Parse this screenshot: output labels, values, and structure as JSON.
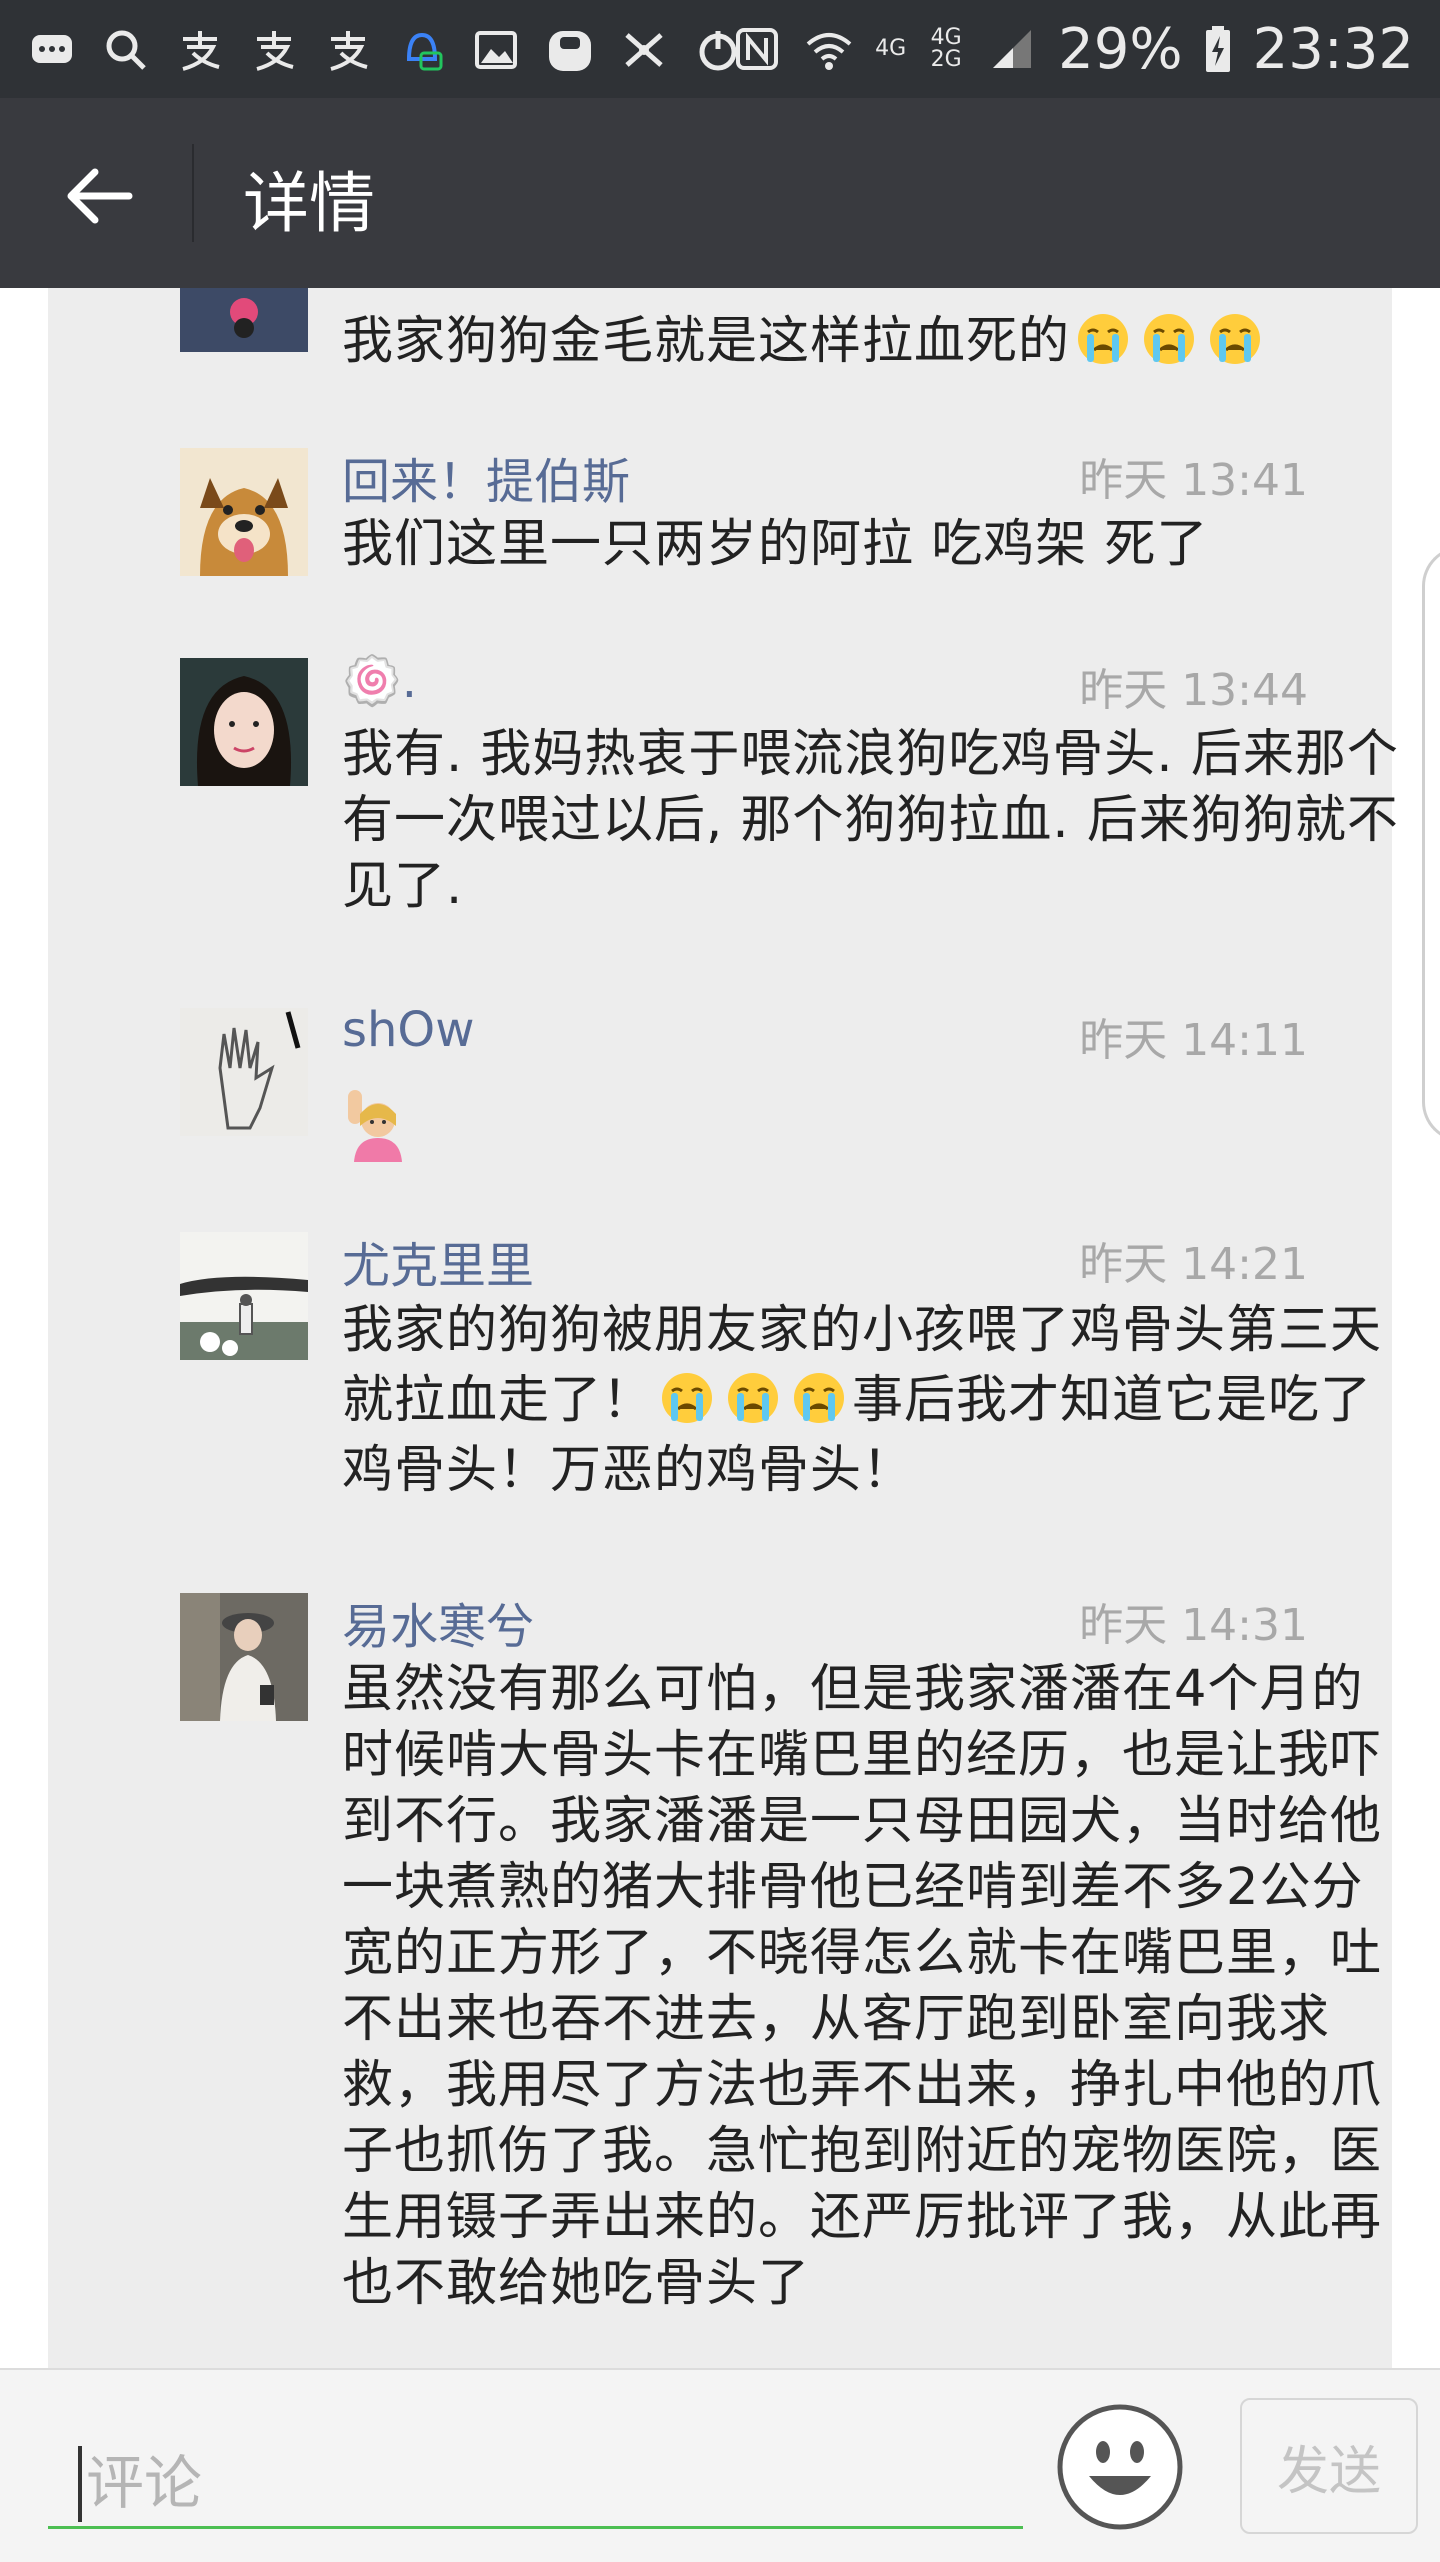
{
  "status_bar": {
    "left_icons": [
      "message-icon",
      "search-icon",
      "alipay-icon",
      "alipay-icon",
      "alipay-icon",
      "notification-bell-icon",
      "gallery-icon",
      "galaxy-icon",
      "tools-icon",
      "power-icon"
    ],
    "network_4g": "4G",
    "network_4g_2g": "4G 2G",
    "battery_percent": "29%",
    "time": "23:32"
  },
  "app_bar": {
    "title": "详情"
  },
  "comments": [
    {
      "name": "",
      "time": "",
      "text_before_emoji": "我家狗狗金毛就是这样拉血死的",
      "emoji": "crying-face-emoji",
      "emoji_count": 3,
      "text_after_emoji": ""
    },
    {
      "name": "回来！提伯斯",
      "time": "昨天 13:41",
      "text": "我们这里一只两岁的阿拉  吃鸡架 死了"
    },
    {
      "name": "🍥.",
      "time": "昨天 13:44",
      "text": "我有. 我妈热衷于喂流浪狗吃鸡骨头. 后来那个有一次喂过以后, 那个狗狗拉血. 后来狗狗就不见了."
    },
    {
      "name": "shOw",
      "time": "昨天 14:11",
      "emoji": "raising-hand-emoji"
    },
    {
      "name": "尤克里里",
      "time": "昨天 14:21",
      "text_before_emoji": "我家的狗狗被朋友家的小孩喂了鸡骨头第三天就拉血走了！",
      "emoji": "crying-face-emoji",
      "emoji_count": 3,
      "text_after_emoji": "事后我才知道它是吃了鸡骨头！万恶的鸡骨头！"
    },
    {
      "name": "易水寒兮",
      "time": "昨天 14:31",
      "text": "虽然没有那么可怕，但是我家潘潘在4个月的时候啃大骨头卡在嘴巴里的经历，也是让我吓到不行。我家潘潘是一只母田园犬，当时给他一块煮熟的猪大排骨他已经啃到差不多2公分宽的正方形了，不晓得怎么就卡在嘴巴里，吐不出来也吞不进去，从客厅跑到卧室向我求救，我用尽了方法也弄不出来，挣扎中他的爪子也抓伤了我。急忙抱到附近的宠物医院，医生用镊子弄出来的。还严厉批评了我，从此再也不敢给她吃骨头了"
    }
  ],
  "bottom_bar": {
    "comment_placeholder": "评论",
    "comment_value": "",
    "send_label": "发送"
  },
  "colors": {
    "status_bar_bg": "#2f3236",
    "app_bar_bg": "#393a3f",
    "panel_bg": "#ededed",
    "name_color": "#576b95",
    "time_color": "#a8a8a8",
    "input_underline": "#4cbf52"
  }
}
